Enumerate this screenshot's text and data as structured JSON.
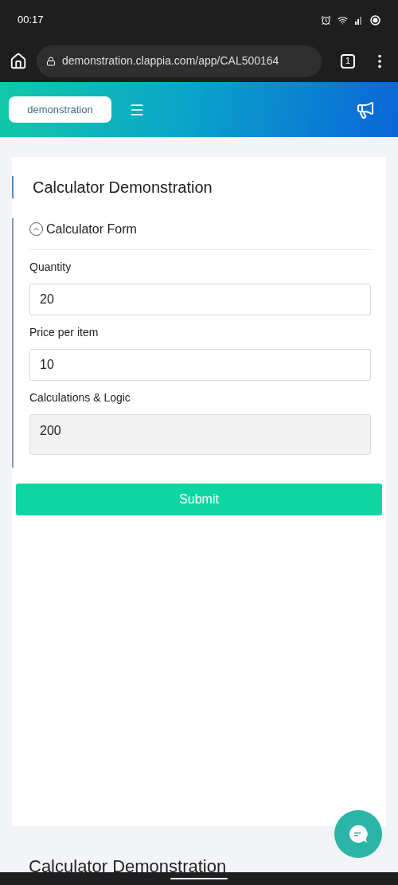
{
  "status_bar": {
    "time": "00:17"
  },
  "browser": {
    "url": "demonstration.clappia.com/app/CAL500164",
    "tab_count": "1"
  },
  "header": {
    "workspace": "demonstration"
  },
  "form": {
    "title": "Calculator Demonstration",
    "section": {
      "title": "Calculator Form",
      "expanded": true,
      "fields": [
        {
          "label": "Quantity",
          "value": "20",
          "kind": "input"
        },
        {
          "label": "Price per item",
          "value": "10",
          "kind": "input"
        },
        {
          "label": "Calculations & Logic",
          "value": "200",
          "kind": "computed"
        }
      ]
    },
    "submit": "Submit"
  },
  "footer": {
    "title": "Calculator Demonstration"
  }
}
